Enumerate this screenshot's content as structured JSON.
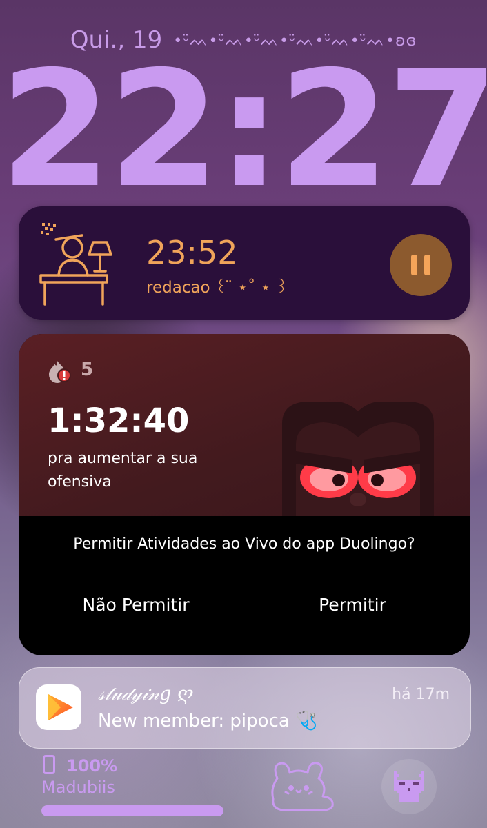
{
  "lockscreen": {
    "date": "Qui., 19",
    "date_decoration": "•ᵕ̈ᨓ•ᵕ̈ᨓ•ᵕ̈ᨓ•ᵕ̈ᨓ•ᵕ̈ᨓ•ᵕ̈ᨓ•ʚɞ",
    "time": "22:27"
  },
  "timer_activity": {
    "time": "23:52",
    "label": "redacao ꒰ ̈ ⋆˚ ⋆ ꒱",
    "icon": "study-desk-icon",
    "control_icon": "pause-icon",
    "accent_color": "#f0a45a"
  },
  "duolingo_activity": {
    "streak_count": "5",
    "countdown": "1:32:40",
    "message": "pra aumentar a sua ofensiva",
    "prompt": "Permitir Atividades ao Vivo do app Duolingo?",
    "deny_label": "Não Permitir",
    "allow_label": "Permitir",
    "icon": "streak-flame-icon",
    "mascot": "angry-owl"
  },
  "notification": {
    "app_icon": "play-icon",
    "title": "𝓈𝓉𝓊𝒹𝓎𝒾𝓃𝑔 ღ",
    "time": "há 17m",
    "body": "New member: pipoca 🩺"
  },
  "widgets": {
    "battery_percent": "100%",
    "battery_level": 1.0,
    "device_name": "Madubiis",
    "icons": [
      "phone-icon",
      "bunny-icon",
      "pixel-cat-icon"
    ],
    "accent_color": "#c99af0"
  }
}
